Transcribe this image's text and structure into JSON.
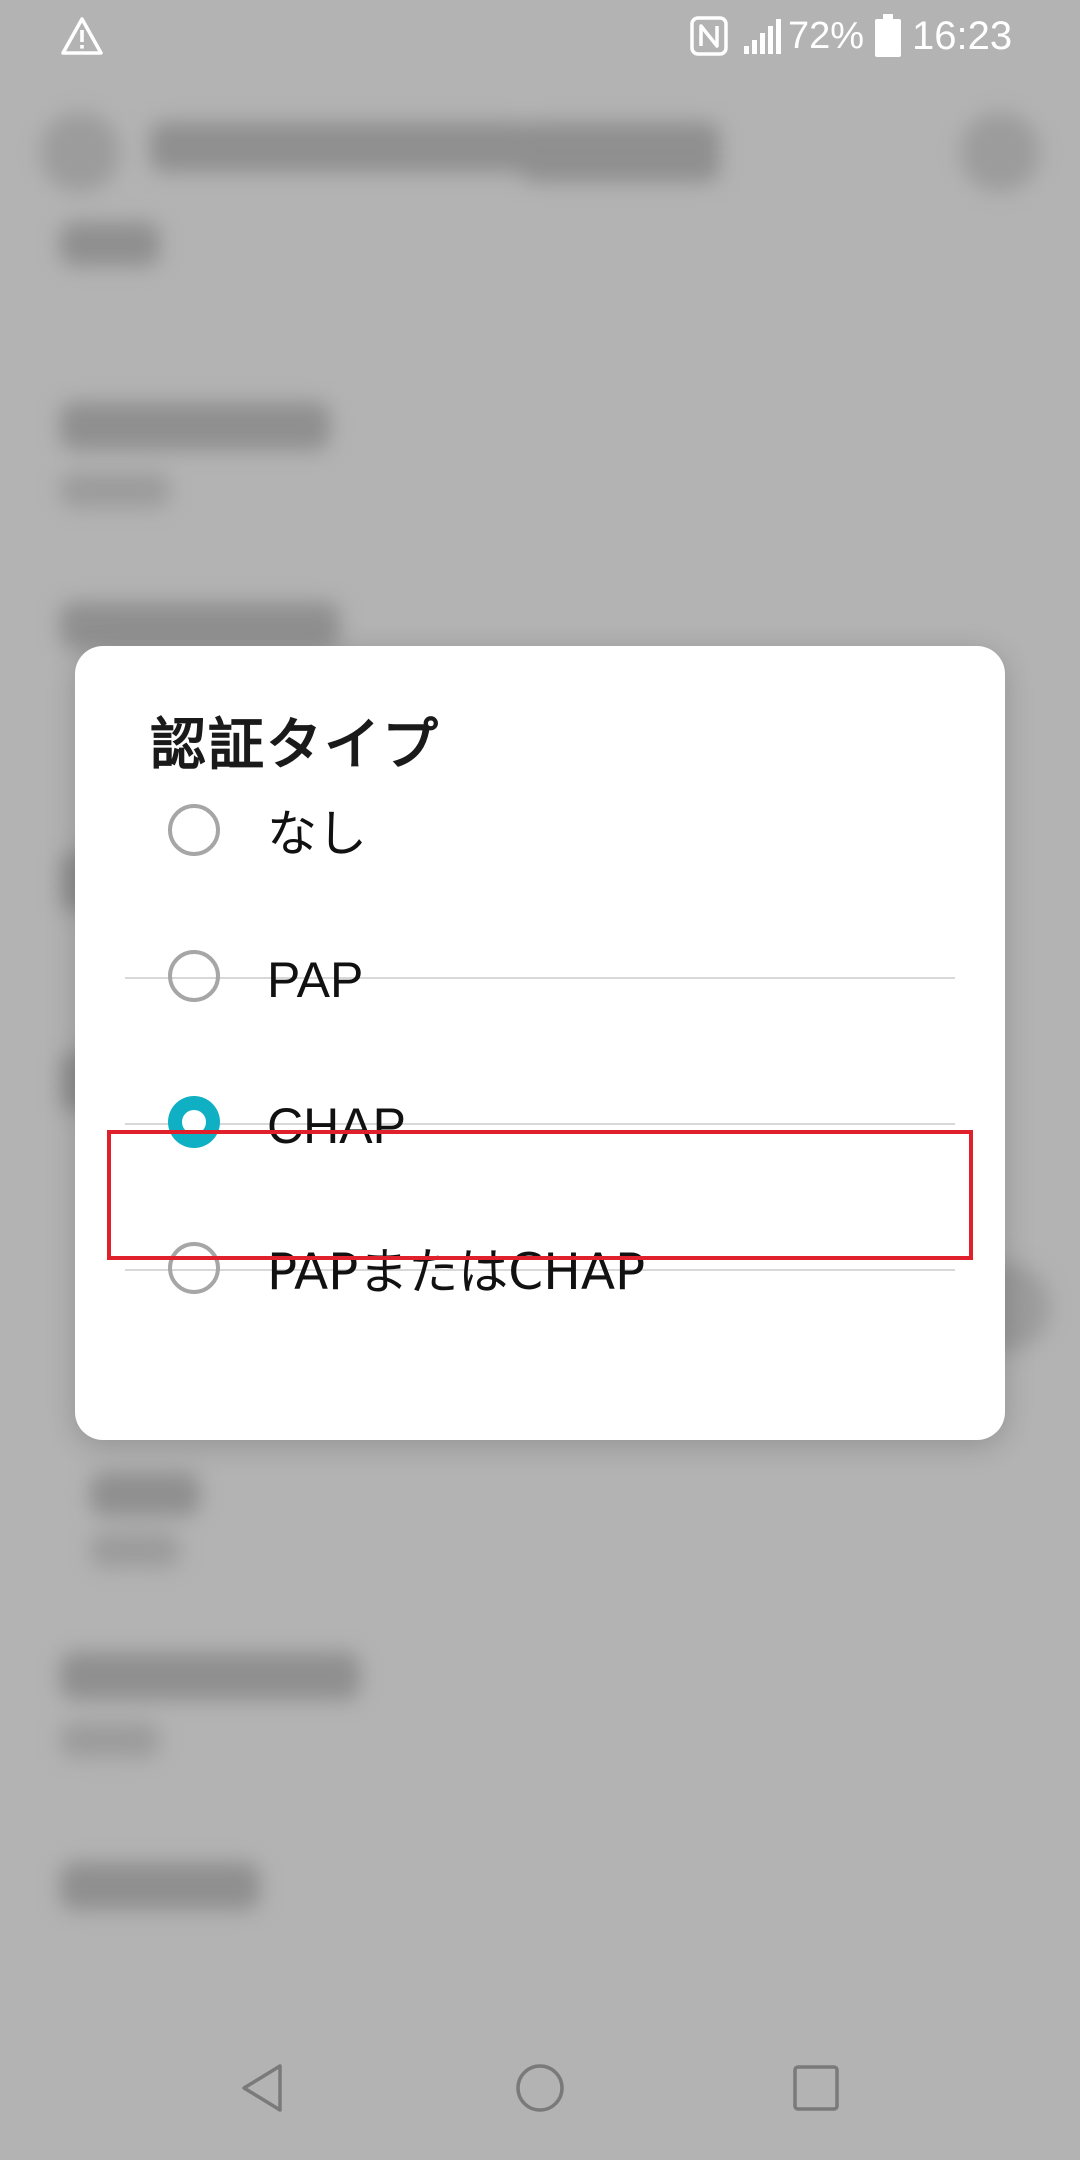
{
  "status_bar": {
    "icons": [
      "warning-icon",
      "nfc-icon",
      "signal-icon",
      "battery-icon"
    ],
    "battery_percent": "72%",
    "time": "16:23"
  },
  "dialog": {
    "title": "認証タイプ",
    "options": [
      {
        "label": "なし",
        "selected": false
      },
      {
        "label": "PAP",
        "selected": false
      },
      {
        "label": "CHAP",
        "selected": true
      },
      {
        "label": "PAPまたはCHAP",
        "selected": false
      }
    ],
    "accent_color": "#10b0c4",
    "highlight_color": "#e0202a"
  },
  "nav_bar": {
    "icons": [
      "back-icon",
      "home-icon",
      "recent-apps-icon"
    ]
  }
}
